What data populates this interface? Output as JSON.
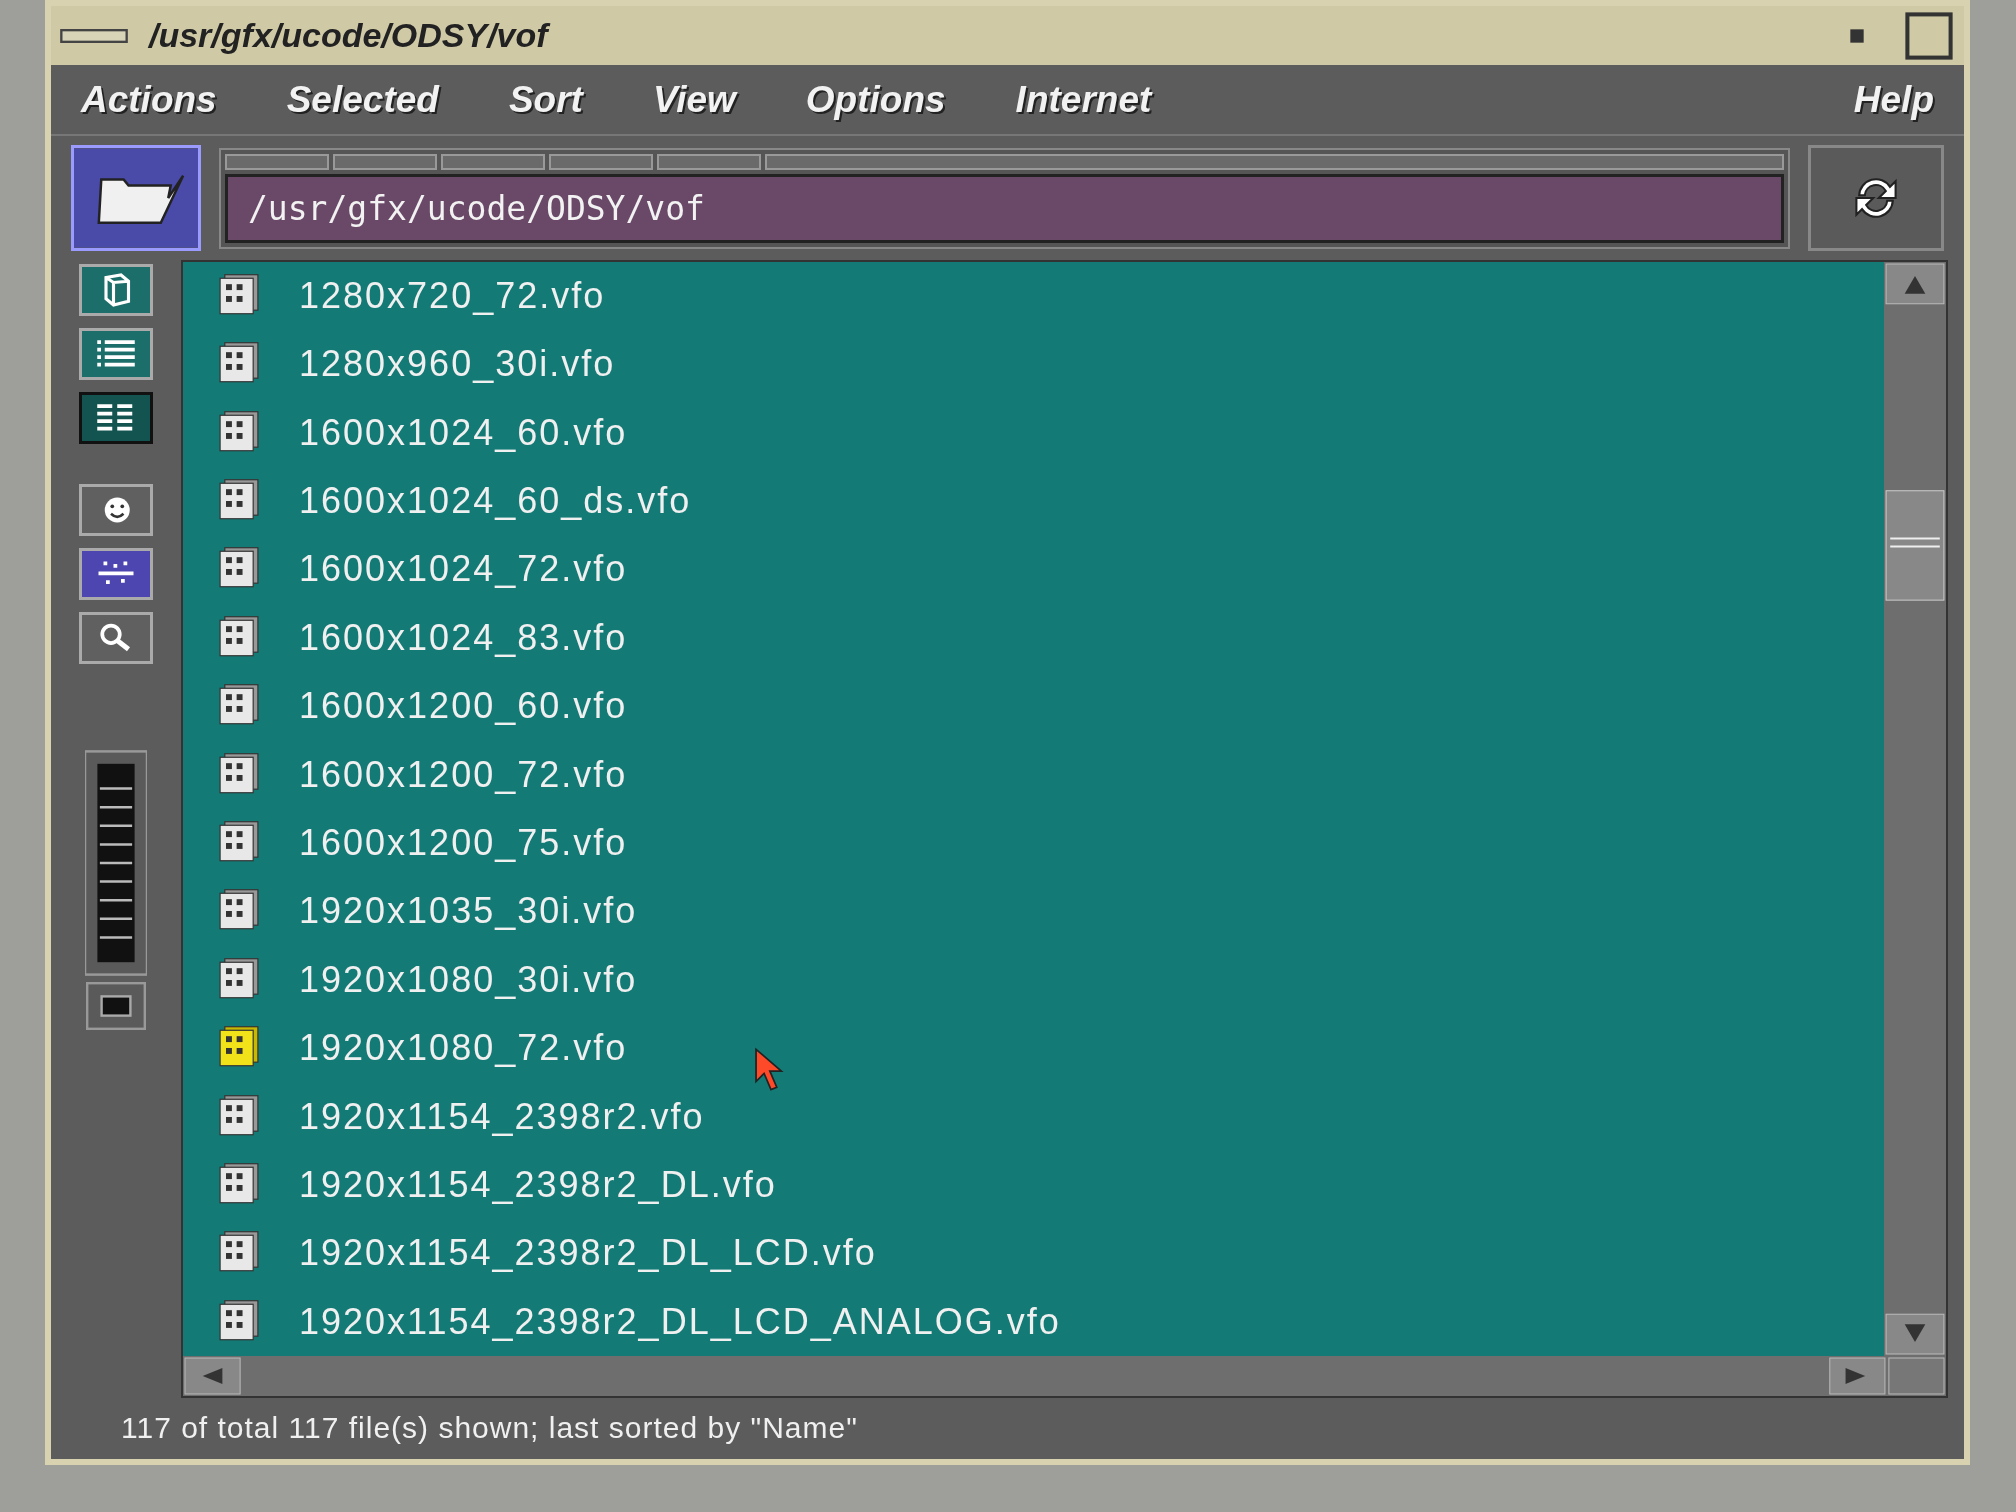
{
  "window": {
    "title": "/usr/gfx/ucode/ODSY/vof"
  },
  "menu": [
    "Actions",
    "Selected",
    "Sort",
    "View",
    "Options",
    "Internet"
  ],
  "help_menu": "Help",
  "path_field": {
    "value": "/usr/gfx/ucode/ODSY/vof"
  },
  "view_buttons": [
    {
      "kind": "icons",
      "selected": false
    },
    {
      "kind": "list",
      "selected": false
    },
    {
      "kind": "columns",
      "selected": true
    }
  ],
  "tool_buttons": [
    {
      "kind": "face",
      "active": false
    },
    {
      "kind": "filter",
      "active": true
    },
    {
      "kind": "search",
      "active": false
    }
  ],
  "files": [
    {
      "name": "1280x720_72.vfo",
      "selected": false
    },
    {
      "name": "1280x960_30i.vfo",
      "selected": false
    },
    {
      "name": "1600x1024_60.vfo",
      "selected": false
    },
    {
      "name": "1600x1024_60_ds.vfo",
      "selected": false
    },
    {
      "name": "1600x1024_72.vfo",
      "selected": false
    },
    {
      "name": "1600x1024_83.vfo",
      "selected": false
    },
    {
      "name": "1600x1200_60.vfo",
      "selected": false
    },
    {
      "name": "1600x1200_72.vfo",
      "selected": false
    },
    {
      "name": "1600x1200_75.vfo",
      "selected": false
    },
    {
      "name": "1920x1035_30i.vfo",
      "selected": false
    },
    {
      "name": "1920x1080_30i.vfo",
      "selected": false
    },
    {
      "name": "1920x1080_72.vfo",
      "selected": true
    },
    {
      "name": "1920x1154_2398r2.vfo",
      "selected": false
    },
    {
      "name": "1920x1154_2398r2_DL.vfo",
      "selected": false
    },
    {
      "name": "1920x1154_2398r2_DL_LCD.vfo",
      "selected": false
    },
    {
      "name": "1920x1154_2398r2_DL_LCD_ANALOG.vfo",
      "selected": false
    }
  ],
  "status_bar": "117 of total 117 file(s) shown; last sorted by \"Name\""
}
